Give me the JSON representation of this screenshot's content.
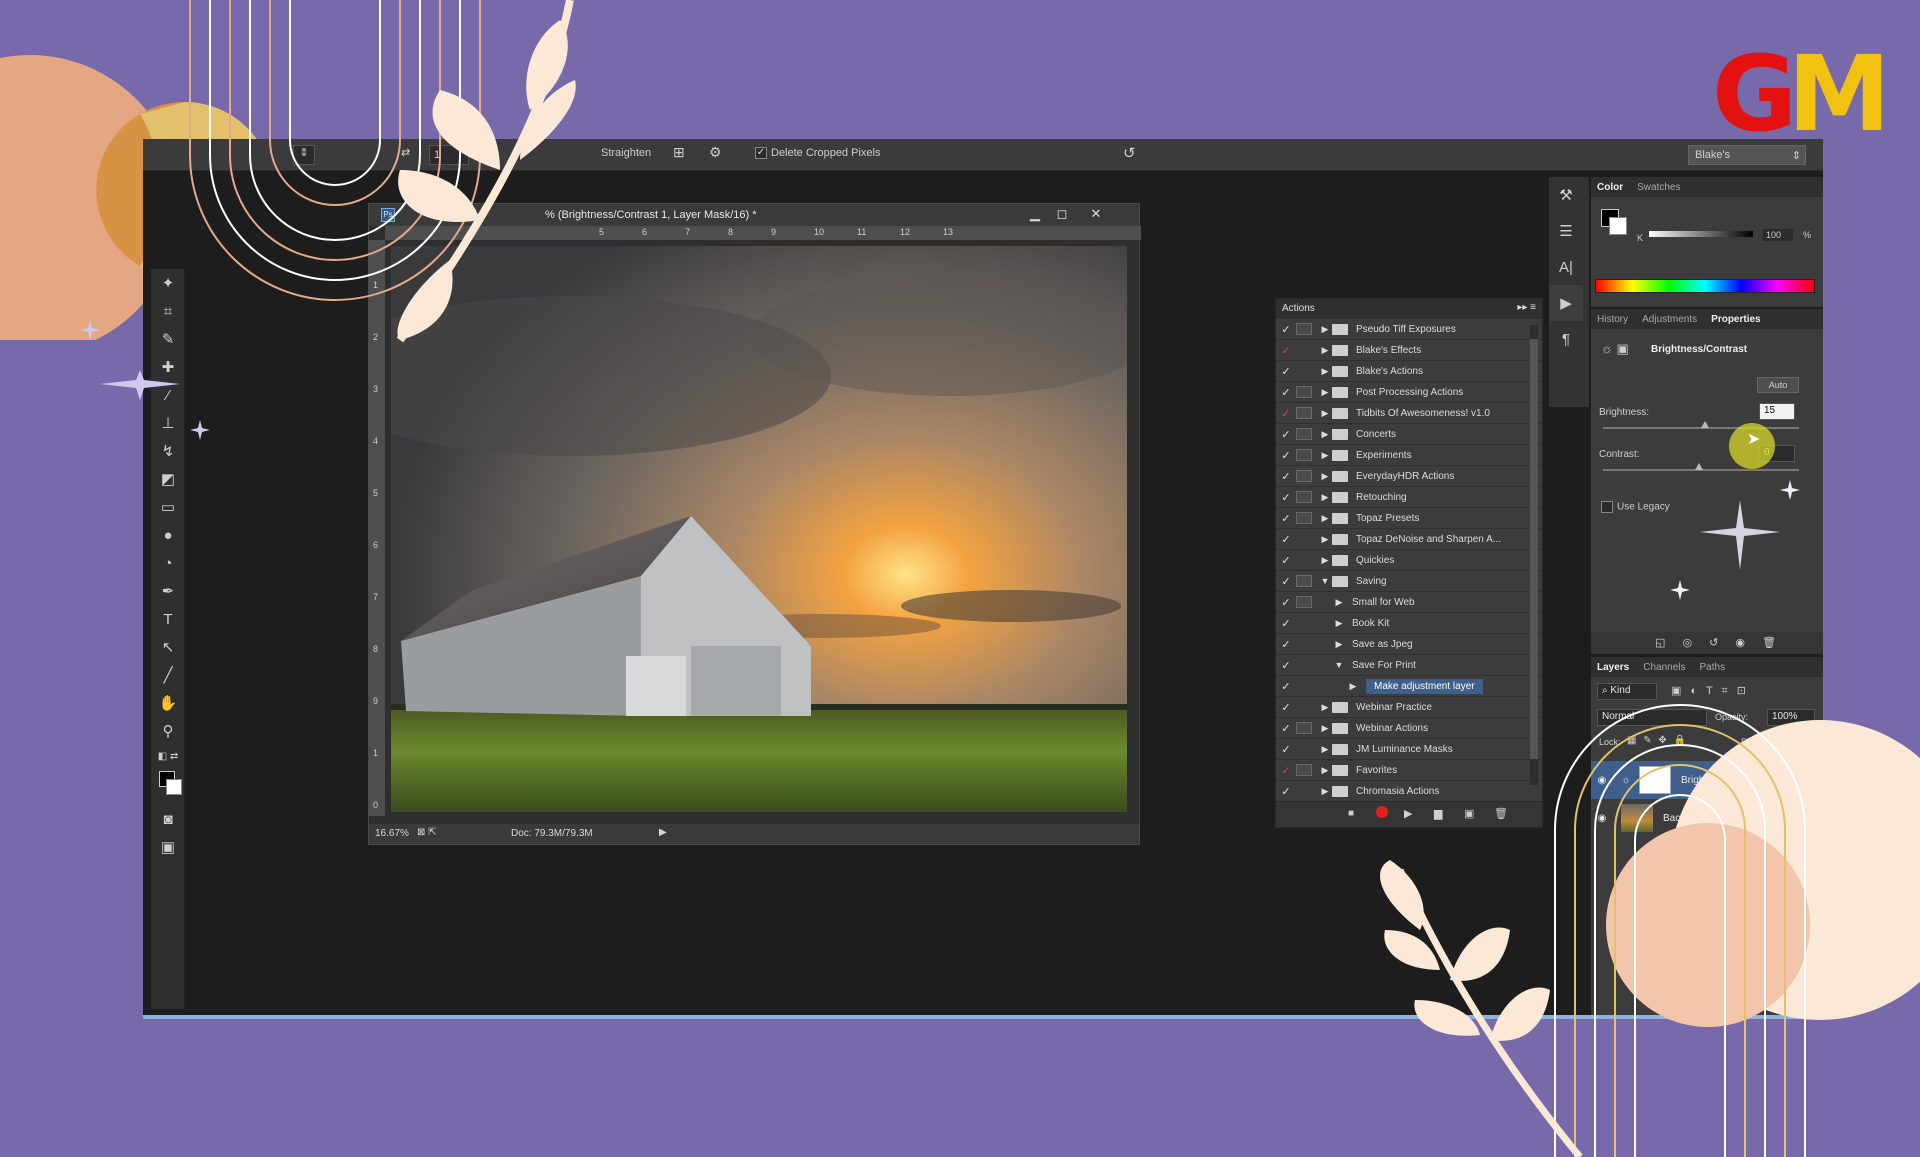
{
  "branding": {
    "logo_g": "G",
    "logo_m": "M"
  },
  "options_bar": {
    "straighten": "Straighten",
    "delete_cropped": "Delete Cropped Pixels",
    "workspace": "Blake's",
    "value_field": "1"
  },
  "document": {
    "title": "% (Brightness/Contrast 1, Layer Mask/16) *",
    "ruler_top": [
      "5",
      "6",
      "7",
      "8",
      "9",
      "10",
      "11",
      "12",
      "13"
    ],
    "ruler_left": [
      "1",
      "2",
      "3",
      "4",
      "5",
      "6",
      "7",
      "8",
      "9",
      "1",
      "0"
    ],
    "zoom": "16.67%",
    "doc_size": "Doc: 79.3M/79.3M"
  },
  "actions_panel": {
    "title": "Actions",
    "items": [
      {
        "label": "Pseudo Tiff Exposures",
        "check": "✓",
        "indent": 0,
        "toggle": "▶",
        "folder": true,
        "dialog": true,
        "check_red": false
      },
      {
        "label": "Blake's Effects",
        "check": "✓",
        "indent": 0,
        "toggle": "▶",
        "folder": true,
        "dialog": false,
        "check_red": true
      },
      {
        "label": "Blake's Actions",
        "check": "✓",
        "indent": 0,
        "toggle": "▶",
        "folder": true,
        "dialog": false,
        "check_red": false
      },
      {
        "label": "Post Processing Actions",
        "check": "✓",
        "indent": 0,
        "toggle": "▶",
        "folder": true,
        "dialog": true,
        "check_red": false
      },
      {
        "label": "Tidbits Of Awesomeness! v1.0",
        "check": "✓",
        "indent": 0,
        "toggle": "▶",
        "folder": true,
        "dialog": true,
        "check_red": true
      },
      {
        "label": "Concerts",
        "check": "✓",
        "indent": 0,
        "toggle": "▶",
        "folder": true,
        "dialog": true,
        "check_red": false
      },
      {
        "label": "Experiments",
        "check": "✓",
        "indent": 0,
        "toggle": "▶",
        "folder": true,
        "dialog": true,
        "check_red": false
      },
      {
        "label": "EverydayHDR Actions",
        "check": "✓",
        "indent": 0,
        "toggle": "▶",
        "folder": true,
        "dialog": true,
        "check_red": false
      },
      {
        "label": "Retouching",
        "check": "✓",
        "indent": 0,
        "toggle": "▶",
        "folder": true,
        "dialog": true,
        "check_red": false
      },
      {
        "label": "Topaz Presets",
        "check": "✓",
        "indent": 0,
        "toggle": "▶",
        "folder": true,
        "dialog": true,
        "check_red": false
      },
      {
        "label": "Topaz DeNoise and Sharpen A...",
        "check": "✓",
        "indent": 0,
        "toggle": "▶",
        "folder": true,
        "dialog": false,
        "check_red": false
      },
      {
        "label": "Quickies",
        "check": "✓",
        "indent": 0,
        "toggle": "▶",
        "folder": true,
        "dialog": false,
        "check_red": false
      },
      {
        "label": "Saving",
        "check": "✓",
        "indent": 0,
        "toggle": "▼",
        "folder": true,
        "dialog": true,
        "check_red": false
      },
      {
        "label": "Small for Web",
        "check": "✓",
        "indent": 1,
        "toggle": "▶",
        "folder": false,
        "dialog": true,
        "check_red": false
      },
      {
        "label": "Book Kit",
        "check": "✓",
        "indent": 1,
        "toggle": "▶",
        "folder": false,
        "dialog": false,
        "check_red": false
      },
      {
        "label": "Save as Jpeg",
        "check": "✓",
        "indent": 1,
        "toggle": "▶",
        "folder": false,
        "dialog": false,
        "check_red": false
      },
      {
        "label": "Save For Print",
        "check": "✓",
        "indent": 1,
        "toggle": "▼",
        "folder": false,
        "dialog": false,
        "check_red": false
      },
      {
        "label": "Make adjustment layer",
        "check": "✓",
        "indent": 2,
        "toggle": "▶",
        "folder": false,
        "dialog": false,
        "check_red": false,
        "selected": true
      },
      {
        "label": "Webinar Practice",
        "check": "✓",
        "indent": 0,
        "toggle": "▶",
        "folder": true,
        "dialog": false,
        "check_red": false
      },
      {
        "label": "Webinar Actions",
        "check": "✓",
        "indent": 0,
        "toggle": "▶",
        "folder": true,
        "dialog": true,
        "check_red": false
      },
      {
        "label": "JM Luminance Masks",
        "check": "✓",
        "indent": 0,
        "toggle": "▶",
        "folder": true,
        "dialog": false,
        "check_red": false
      },
      {
        "label": "Favorites",
        "check": "✓",
        "indent": 0,
        "toggle": "▶",
        "folder": true,
        "dialog": true,
        "check_red": true
      },
      {
        "label": "Chromasia Actions",
        "check": "✓",
        "indent": 0,
        "toggle": "▶",
        "folder": true,
        "dialog": false,
        "check_red": false
      }
    ]
  },
  "color_panel": {
    "tabs": [
      "Color",
      "Swatches"
    ],
    "k_label": "K",
    "k_value": "100",
    "k_unit": "%"
  },
  "properties_panel": {
    "tabs": [
      "History",
      "Adjustments",
      "Properties"
    ],
    "title": "Brightness/Contrast",
    "auto": "Auto",
    "brightness_label": "Brightness:",
    "brightness_value": "15",
    "contrast_label": "Contrast:",
    "contrast_value": "0",
    "use_legacy": "Use Legacy"
  },
  "layers_panel": {
    "tabs": [
      "Layers",
      "Channels",
      "Paths"
    ],
    "kind": "Kind",
    "blend_mode": "Normal",
    "opacity_label": "Opacity:",
    "opacity_value": "100%",
    "lock_label": "Lock:",
    "fill_label": "Fill:",
    "fill_value": "100%",
    "layers": [
      {
        "name": "Brightness/C...",
        "selected": true
      },
      {
        "name": "Background",
        "selected": false
      }
    ]
  },
  "colors": {
    "bg": "#7769aa",
    "ps_bg": "#1d1d1d",
    "panel": "#3c3c3c",
    "selection": "#3e5f8c"
  }
}
